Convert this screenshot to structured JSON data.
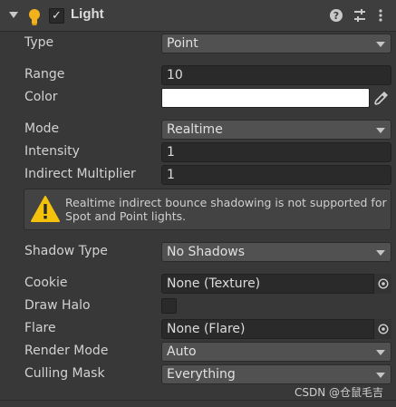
{
  "header": {
    "title": "Light",
    "enabled": true,
    "icons": [
      "foldout-arrow-icon",
      "light-bulb-icon",
      "help-icon",
      "preset-icon",
      "context-menu-icon"
    ]
  },
  "properties": {
    "type": {
      "label": "Type",
      "value": "Point"
    },
    "range": {
      "label": "Range",
      "value": "10"
    },
    "color": {
      "label": "Color",
      "value": "#ffffff"
    },
    "mode": {
      "label": "Mode",
      "value": "Realtime"
    },
    "intensity": {
      "label": "Intensity",
      "value": "1"
    },
    "indirect_multiplier": {
      "label": "Indirect Multiplier",
      "value": "1"
    },
    "help_message": "Realtime indirect bounce shadowing is not supported for Spot and Point lights.",
    "shadow_type": {
      "label": "Shadow Type",
      "value": "No Shadows"
    },
    "cookie": {
      "label": "Cookie",
      "value": "None (Texture)"
    },
    "draw_halo": {
      "label": "Draw Halo",
      "checked": false
    },
    "flare": {
      "label": "Flare",
      "value": "None (Flare)"
    },
    "render_mode": {
      "label": "Render Mode",
      "value": "Auto"
    },
    "culling_mask": {
      "label": "Culling Mask",
      "value": "Everything"
    }
  },
  "watermark": "CSDN @仓鼠毛吉",
  "colors": {
    "background": "#383838",
    "field": "#2a2a2a",
    "dropdown": "#515151",
    "warning": "#f4c20d"
  }
}
